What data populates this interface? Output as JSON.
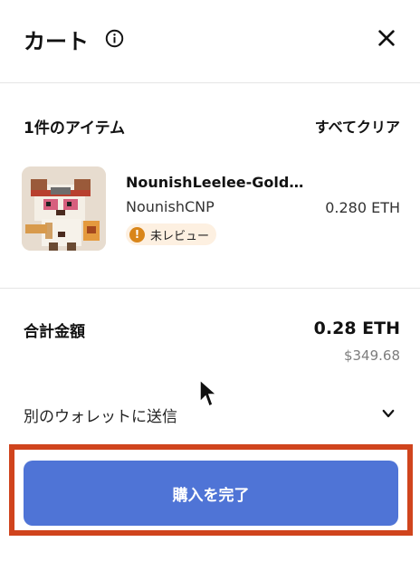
{
  "header": {
    "title": "カート",
    "info_icon": "info-icon",
    "close_icon": "close-icon"
  },
  "items_section": {
    "count_label": "1件のアイテム",
    "clear_all_label": "すべてクリア"
  },
  "cart_item": {
    "name": "NounishLeelee-Gold…",
    "collection": "NounishCNP",
    "price": "0.280 ETH",
    "badge_icon": "!",
    "badge_label": "未レビュー"
  },
  "summary": {
    "total_label": "合計金額",
    "total_eth": "0.28 ETH",
    "total_usd": "$349.68"
  },
  "send_option": {
    "label": "別のウォレットに送信",
    "icon": "chevron-down-icon"
  },
  "purchase": {
    "label": "購入を完了"
  },
  "colors": {
    "accent": "#4f74d6",
    "highlight": "#d0441d",
    "badge_bg": "#fdf0e1",
    "badge_icon": "#d9861a"
  }
}
